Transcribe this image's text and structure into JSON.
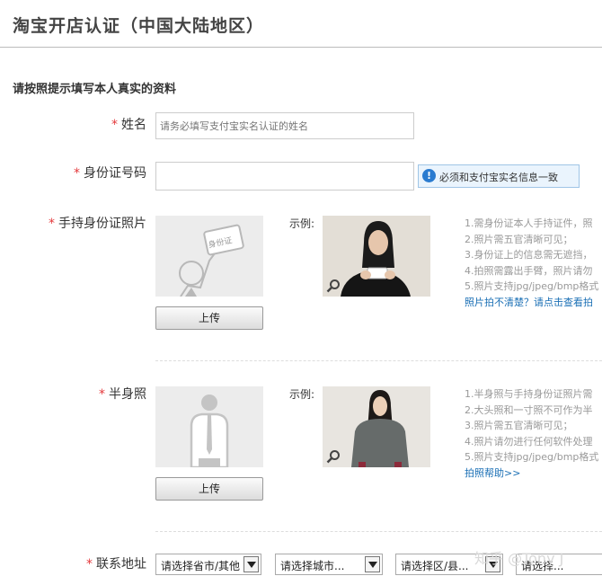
{
  "header": {
    "title": "淘宝开店认证（中国大陆地区）"
  },
  "form": {
    "section_title": "请按照提示填写本人真实的资料",
    "required_mark": "*",
    "name": {
      "label": "姓名",
      "placeholder": "请务必填写支付宝实名认证的姓名",
      "value": ""
    },
    "id_number": {
      "label": "身份证号码",
      "value": "",
      "tip": "必须和支付宝实名信息一致",
      "tip_icon": "!"
    },
    "id_photo": {
      "label": "手持身份证照片",
      "placeholder_card_text": "身份证",
      "upload_label": "上传",
      "sample_label": "示例:",
      "rules": [
        "1.需身份证本人手持证件，照",
        "2.照片需五官清晰可见；",
        "3.身份证上的信息需无遮挡，",
        "4.拍照需露出手臂，照片请勿",
        "5.照片支持jpg/jpeg/bmp格式"
      ],
      "help_link": "照片拍不清楚？请点击查看拍"
    },
    "half_body": {
      "label": "半身照",
      "upload_label": "上传",
      "sample_label": "示例:",
      "rules": [
        "1.半身照与手持身份证照片需",
        "2.大头照和一寸照不可作为半",
        "3.照片需五官清晰可见；",
        "4.照片请勿进行任何软件处理",
        "5.照片支持jpg/jpeg/bmp格式"
      ],
      "help_link": "拍照帮助>>"
    },
    "address": {
      "label": "联系地址",
      "selects": [
        "请选择省市/其他",
        "请选择城市...",
        "请选择区/县...",
        "请选择..."
      ]
    }
  },
  "watermark": "知乎 @Tony J",
  "colors": {
    "required": "#e4393c",
    "link": "#1a6fb5",
    "tip_bg": "#eaf4fd",
    "tip_icon": "#2a7bd0"
  }
}
